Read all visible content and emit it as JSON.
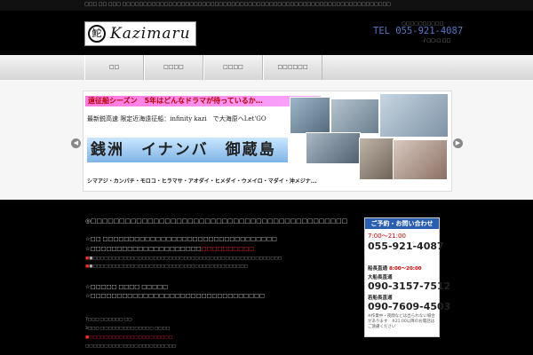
{
  "topbar": {
    "text": "□□□ □□ □□□ □□□□□□□□□□□□□□□□□□□□□□□□□□□□□□□□□□□□□□□□□□□□□□□□□□□□□□□□□□□□□□□□"
  },
  "header": {
    "logo_mark": "鮀",
    "logo_text": "Kazimaru",
    "tel_note": "□□□□□□□□□□",
    "tel": "TEL 055-921-4087",
    "tel_sub": "/ □□:□ □□"
  },
  "nav": {
    "items": [
      "□□",
      "□□□□",
      "□□□□",
      "□□□□□□"
    ]
  },
  "banner": {
    "headline": "遠征船シーズン　5年はどんなドラマが待っているか…",
    "subline": "最新鋭高速 限定近海遠征船：infinity kazi　で大海原へLet'GO",
    "places": "銭洲　イナンバ　御蔵島",
    "fish": "シマアジ・カンパチ・モロコ・ヒラマサ・アオダイ・ヒメダイ・ウメイロ・マダイ・沖メジナ..."
  },
  "content": {
    "lines": [
      "◎□□□□□□□□□□□□□□□□□□□□□□□□□□□□□□□□□□□□□□□□□□□□□",
      "☆□□ □□□□□□□□□□□□□□□□□□□□□□□□□□□□□□□□□",
      "☆□□□□□□□□□□□□□□□□□□□□□",
      "□□□□□□□□□□",
      "■□□□□□□□□□□□□□□□□□□□□□□□□□□□□□□□□□□□□□□□□□□□□□□□□□□",
      "■□□□□□□□□□□□□□□□□□□□□□□□□□□□□□□□□□□□□□□□□□",
      "☆□□□□□ □□□□ □□□□□",
      "☆□□□□□□□□□□□□□□□□□□□□□□□□□□□□□□□□□",
      "7□□□ □□□□□□ □□",
      "3□□□ □□□□□□□□□□□□□□ □□□□",
      "■□□□□□□□□□□□□□□□□□□□□□□",
      "□□□□□□□□□□□□□□□□□□□□□□□□"
    ]
  },
  "sidebar": {
    "heading": "ご予約・お問い合わせ",
    "hours1": "7:00～21:00",
    "phone1": "055-921-4087",
    "label2": "船長直通",
    "hours2": "8:00～20:00",
    "name2": "大船長直通",
    "phone2": "090-3157-7512",
    "name3": "若船長直通",
    "phone3": "090-7609-4503",
    "note": "※作業中・夜間などは出られない場合があります　※21:00以降のお電話はご遠慮ください"
  },
  "colors": {
    "accent": "#5a74c4",
    "sidebar_head": "#2a5fb0",
    "warning": "#ff2a2a"
  }
}
